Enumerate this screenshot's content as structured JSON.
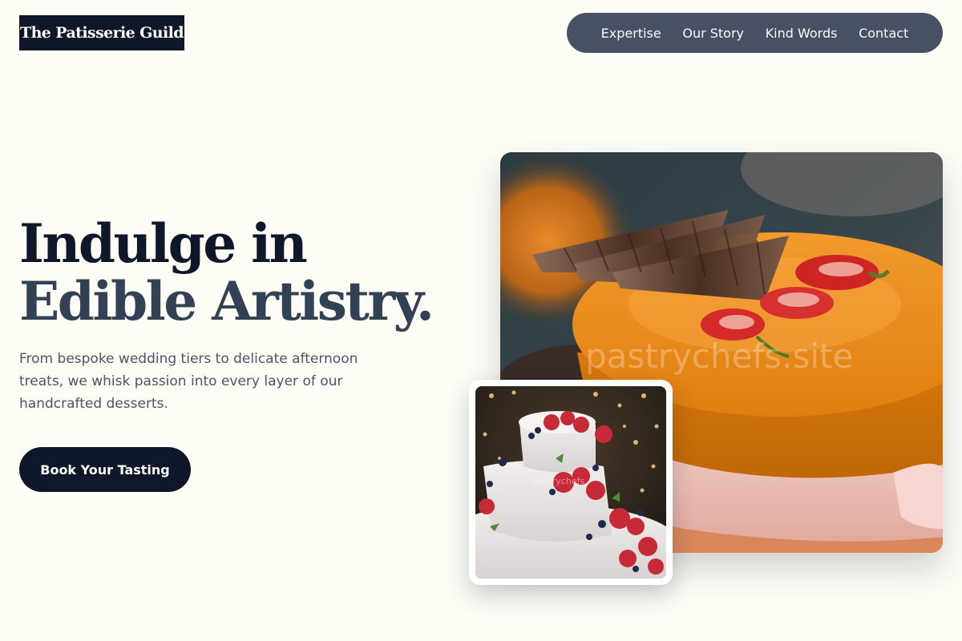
{
  "brand": {
    "name": "The Patisserie Guild"
  },
  "nav": {
    "items": [
      {
        "label": "Expertise"
      },
      {
        "label": "Our Story"
      },
      {
        "label": "Kind Words"
      },
      {
        "label": "Contact"
      }
    ]
  },
  "hero": {
    "headline_line1": "Indulge in",
    "headline_line2": "Edible Artistry.",
    "lead": "From bespoke wedding tiers to delicate afternoon treats, we whisk passion into every layer of our handcrafted desserts.",
    "cta_label": "Book Your Tasting"
  },
  "images": {
    "main_watermark": "pastrychefs.site",
    "inset_watermark": "pastrychefs"
  },
  "colors": {
    "background": "#fdfcf5",
    "primary": "#0f172a",
    "nav_bg": "#475163",
    "secondary_heading": "#334155"
  }
}
